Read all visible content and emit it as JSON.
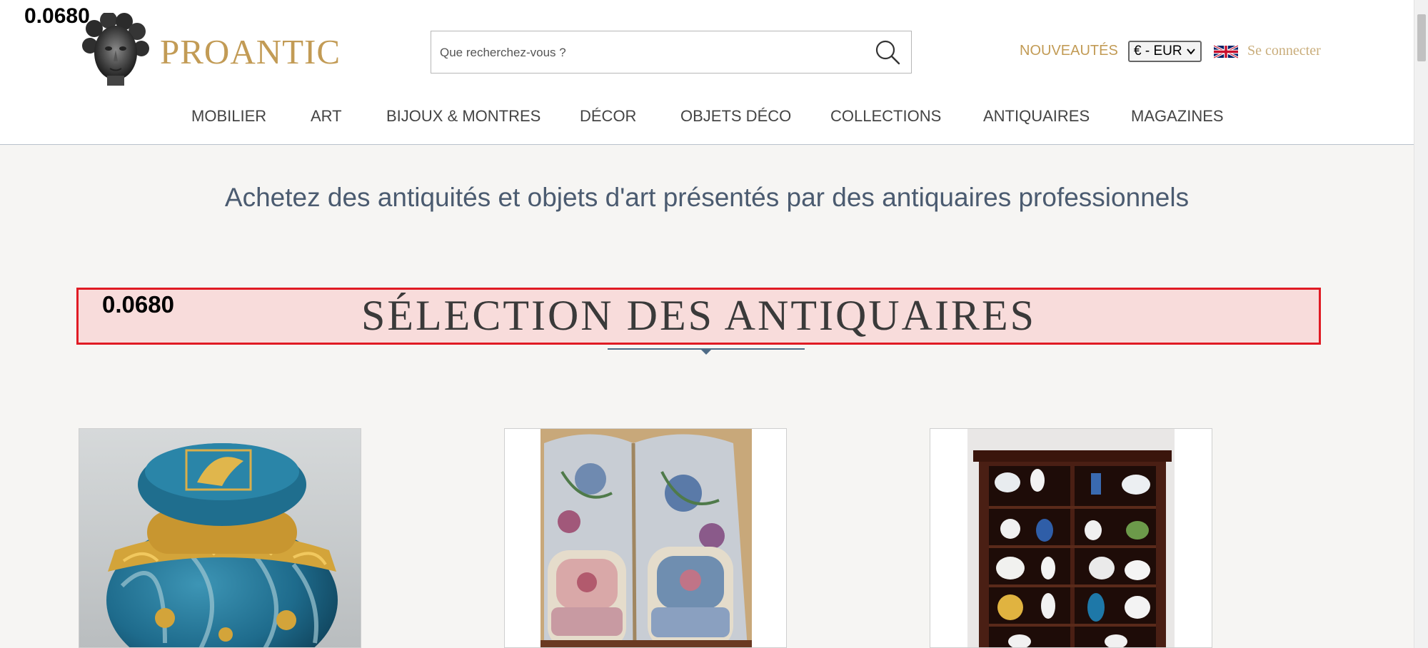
{
  "score_top": "0.0680",
  "logo": {
    "brand": "PROANTIC",
    "image": "classical-head-sculpture-logo"
  },
  "search": {
    "placeholder": "Que recherchez-vous ?",
    "icon": "search-icon"
  },
  "header_links": {
    "nouveautes": "NOUVEAUTÉS",
    "currency": "€ - EUR",
    "language_flag": "uk-flag-icon",
    "connect": "Se connecter"
  },
  "nav": {
    "items": [
      {
        "label": "MOBILIER"
      },
      {
        "label": "ART"
      },
      {
        "label": "BIJOUX & MONTRES"
      },
      {
        "label": "DÉCOR"
      },
      {
        "label": "OBJETS DÉCO"
      },
      {
        "label": "COLLECTIONS"
      },
      {
        "label": "ANTIQUAIRES"
      },
      {
        "label": "MAGAZINES"
      }
    ]
  },
  "tagline": "Achetez des antiquités et objets d'art présentés par des antiquaires professionnels",
  "section": {
    "score": "0.0680",
    "title": "SÉLECTION DES ANTIQUAIRES",
    "highlight_color": "#e01b24"
  },
  "products": [
    {
      "image": "blue-gold-lidded-jar"
    },
    {
      "image": "screen-and-two-armchairs"
    },
    {
      "image": "glass-display-cabinet-with-ceramics"
    }
  ],
  "colors": {
    "brand_gold": "#c29b55",
    "nav_text": "#444444",
    "tagline": "#4b5b70",
    "accent_blue": "#4e6b86"
  }
}
